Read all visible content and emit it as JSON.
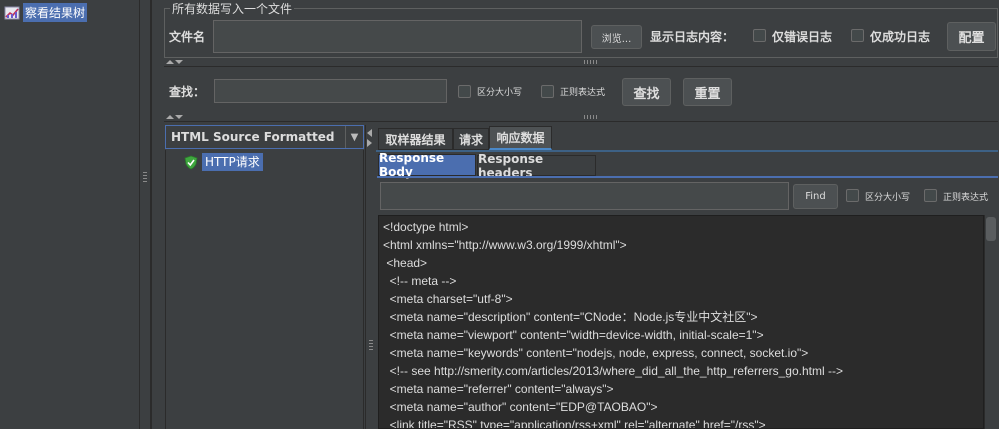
{
  "tree": {
    "item_label": "察看结果树"
  },
  "file_section": {
    "title": "所有数据写入一个文件",
    "file_label": "文件名",
    "filename_value": "",
    "browse_label": "浏览...",
    "log_label": "显示日志内容：",
    "errors_only_label": "仅错误日志",
    "success_only_label": "仅成功日志",
    "config_label": "配置"
  },
  "search": {
    "label": "查找：",
    "value": "",
    "case_sensitive_label": "区分大小写",
    "regex_label": "正则表达式",
    "find_label": "查找",
    "reset_label": "重置"
  },
  "renderer": {
    "selected": "HTML Source Formatted"
  },
  "results": [
    {
      "label": "HTTP请求",
      "status": "success"
    }
  ],
  "tabs": {
    "sampler_result": "取样器结果",
    "request": "请求",
    "response_data": "响应数据",
    "selected": "响应数据"
  },
  "response": {
    "subtab_body": "Response Body",
    "subtab_headers": "Response headers",
    "find_value": "",
    "find_label": "Find",
    "case_sensitive_label": "区分大小写",
    "regex_label": "正则表达式",
    "lines": [
      "<!doctype html>",
      "<html xmlns=\"http://www.w3.org/1999/xhtml\">",
      " <head>",
      "  <!-- meta -->",
      "  <meta charset=\"utf-8\">",
      "  <meta name=\"description\" content=\"CNode：Node.js专业中文社区\">",
      "  <meta name=\"viewport\" content=\"width=device-width, initial-scale=1\">",
      "  <meta name=\"keywords\" content=\"nodejs, node, express, connect, socket.io\">",
      "  <!-- see http://smerity.com/articles/2013/where_did_all_the_http_referrers_go.html -->",
      "  <meta name=\"referrer\" content=\"always\">",
      "  <meta name=\"author\" content=\"EDP@TAOBAO\">",
      "  <link title=\"RSS\" type=\"application/rss+xml\" rel=\"alternate\" href=\"/rss\">"
    ]
  },
  "colors": {
    "selection": "#4b6eaf",
    "background": "#3c3f41",
    "editor_bg": "#2b2b2b",
    "success_green": "#3fa63f"
  }
}
